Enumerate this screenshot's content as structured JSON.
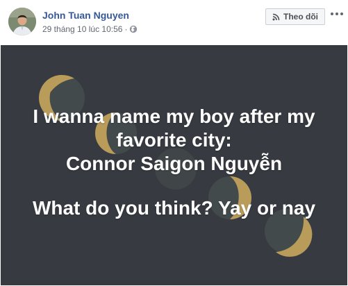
{
  "post": {
    "author": "John Tuan Nguyen",
    "timestamp": "29 tháng 10 lúc 10:56",
    "separator": "·",
    "privacy_icon": "globe-icon",
    "follow_label": "Theo dõi",
    "follow_icon": "rss-icon",
    "more_icon": "ellipsis-icon"
  },
  "status": {
    "line1": "I wanna name my boy after my",
    "line2": "favorite city:",
    "line3": "Connor Saigon Nguyễn",
    "line4": "What do you think? Yay or nay"
  },
  "colors": {
    "background": "#373b41",
    "moon_gold": "#b99b5a",
    "moon_dark": "#434a4c",
    "author_link": "#365899",
    "text": "#ffffff"
  }
}
